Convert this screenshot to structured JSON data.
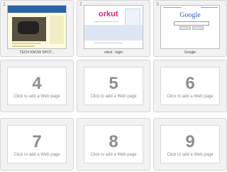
{
  "tiles": [
    {
      "number": "1",
      "caption": "TECH KNOW SPOT..."
    },
    {
      "number": "2",
      "caption": "orkut - login",
      "logo_text": "orkut"
    },
    {
      "number": "3",
      "caption": "Google",
      "logo_text": "Google"
    },
    {
      "number": "4",
      "hint": "Click to add a Web page"
    },
    {
      "number": "5",
      "hint": "Click to add a Web page"
    },
    {
      "number": "6",
      "hint": "Click to add a Web page"
    },
    {
      "number": "7",
      "hint": "Click to add a Web page"
    },
    {
      "number": "8",
      "hint": "Click to add a Web page"
    },
    {
      "number": "9",
      "hint": "Click to add a Web page"
    }
  ],
  "colors": {
    "tile_background": "#f2f2f2",
    "tile_border": "#d6d6d6",
    "placeholder_text": "#8e8e8e"
  }
}
